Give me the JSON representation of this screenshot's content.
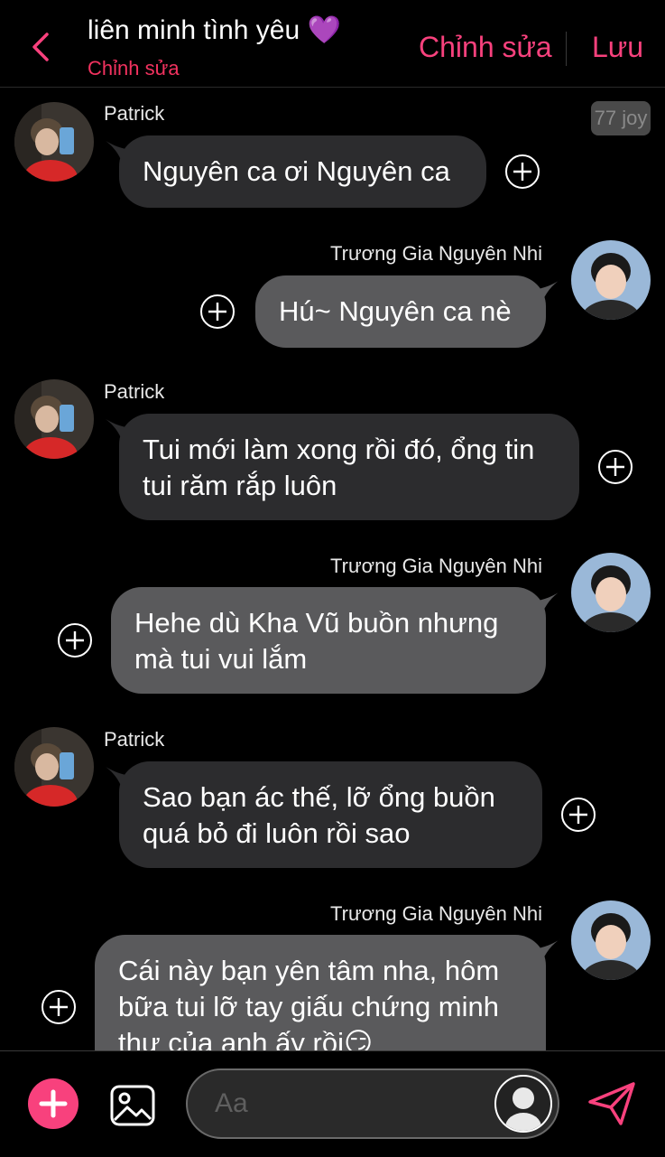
{
  "header": {
    "title": "liên minh tình yêu 💜",
    "subtitle": "Chỉnh sửa",
    "edit_label": "Chỉnh sửa",
    "save_label": "Lưu",
    "accent": "#f8417d"
  },
  "badge": "77 joy",
  "messages": [
    {
      "sender": "Patrick",
      "side": "left",
      "lines": [
        "Nguyên ca ơi Nguyên ca"
      ]
    },
    {
      "sender": "Trương Gia Nguyên Nhi",
      "side": "right",
      "lines": [
        "Hú~ Nguyên ca nè"
      ]
    },
    {
      "sender": "Patrick",
      "side": "left",
      "lines": [
        "Tui mới làm xong rồi đó, ổng tin",
        "tui răm rắp luôn"
      ]
    },
    {
      "sender": "Trương Gia Nguyên Nhi",
      "side": "right",
      "lines": [
        "Hehe dù Kha Vũ buồn nhưng",
        "mà tui vui lắm"
      ]
    },
    {
      "sender": "Patrick",
      "side": "left",
      "lines": [
        "Sao bạn ác thế, lỡ ổng buồn",
        "quá bỏ đi luôn rồi sao"
      ]
    },
    {
      "sender": "Trương Gia Nguyên Nhi",
      "side": "right",
      "lines": [
        "Cái này bạn yên tâm nha, hôm",
        "bữa tui lỡ tay giấu chứng minh",
        "thư của anh ấy rồi😏"
      ]
    }
  ],
  "composer": {
    "placeholder": "Aa",
    "icons": [
      "plus-icon",
      "image-icon",
      "avatar-icon",
      "send-icon"
    ]
  }
}
